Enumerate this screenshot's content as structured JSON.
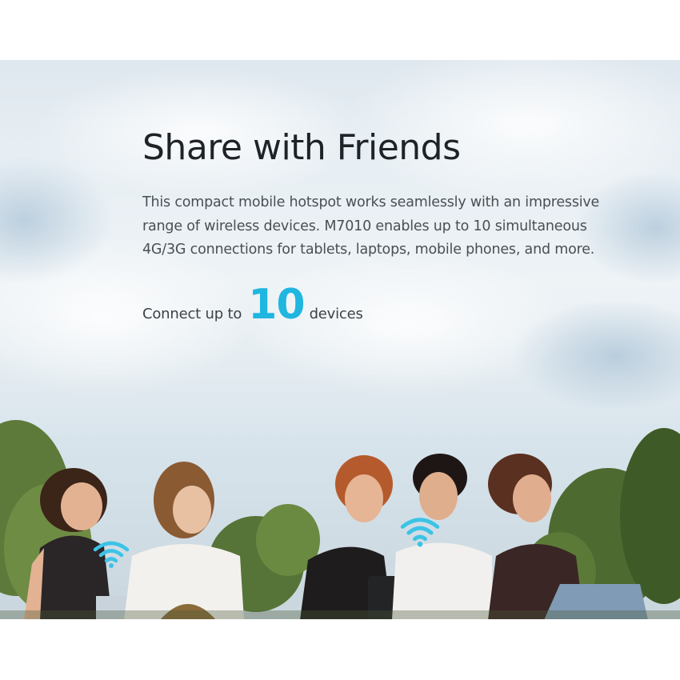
{
  "banner": {
    "title": "Share with Friends",
    "description": "This compact mobile hotspot works seamlessly with an impressive range of wireless devices. M7010 enables up to 10 simultaneous 4G/3G connections for tablets, laptops, mobile phones, and more.",
    "connect": {
      "prefix": "Connect up to",
      "number": "10",
      "suffix": "devices"
    }
  },
  "colors": {
    "accent": "#1fb6e0",
    "title": "#1e2328",
    "body_text": "#4a4f55"
  },
  "icons": [
    "wifi-icon",
    "wifi-icon"
  ]
}
